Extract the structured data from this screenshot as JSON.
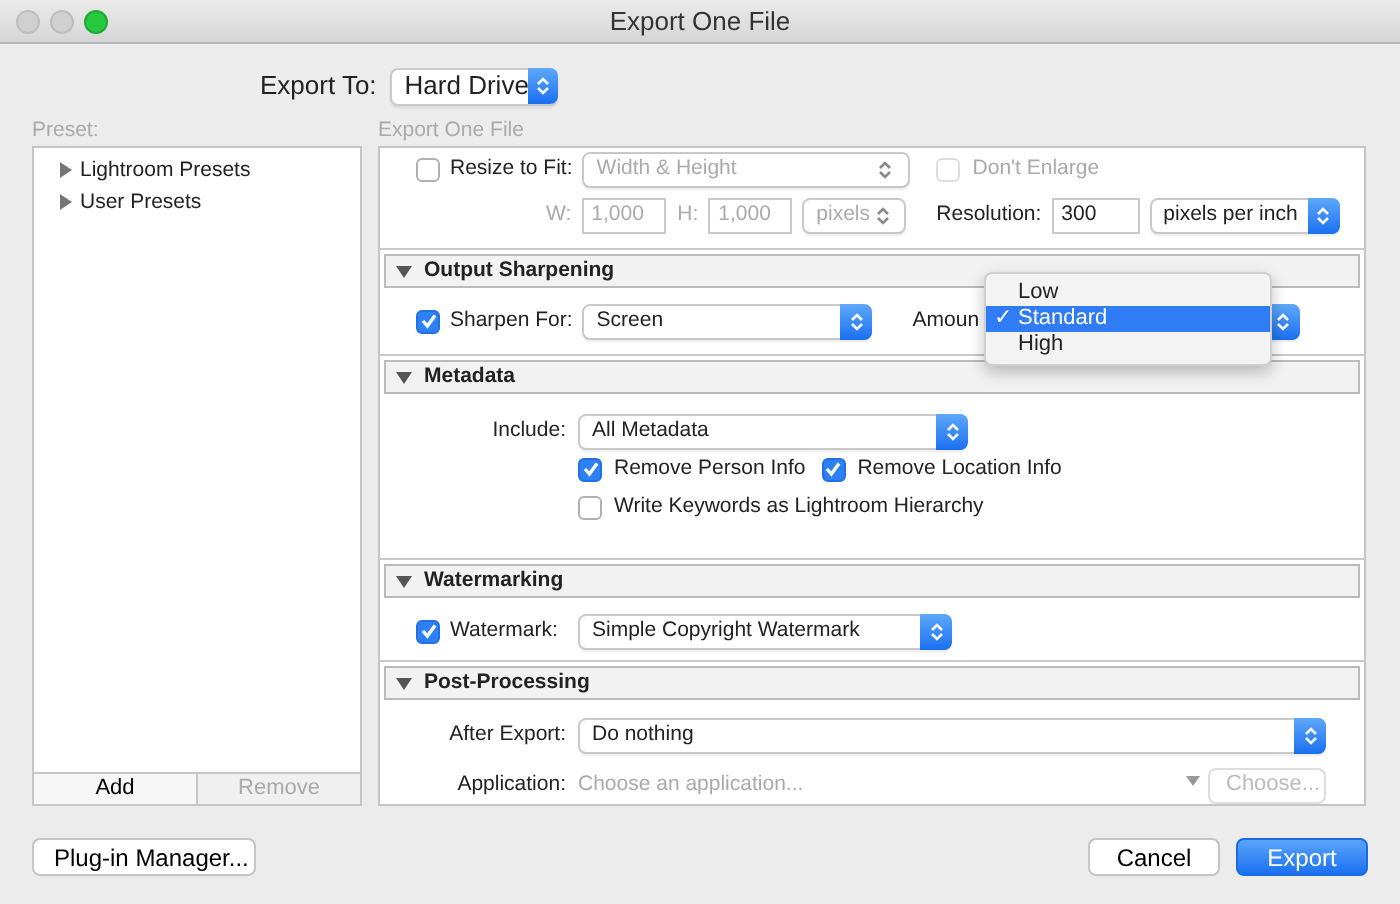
{
  "window": {
    "title": "Export One File"
  },
  "export_to": {
    "label": "Export To:",
    "value": "Hard Drive"
  },
  "preset_panel": {
    "heading": "Preset:",
    "items": [
      {
        "label": "Lightroom Presets",
        "expanded": false
      },
      {
        "label": "User Presets",
        "expanded": false
      }
    ],
    "buttons": [
      {
        "label": "Add",
        "disabled": false
      },
      {
        "label": "Remove",
        "disabled": true
      }
    ]
  },
  "settings": {
    "heading": "Export One File",
    "resize": {
      "label": "Resize to Fit:",
      "checked": false,
      "mode": "Width & Height",
      "dont_enlarge": {
        "label": "Don't Enlarge",
        "checked": false
      },
      "w_label": "W:",
      "w_value": "1,000",
      "h_label": "H:",
      "h_value": "1,000",
      "unit": "pixels"
    },
    "resolution": {
      "label": "Resolution:",
      "value": "300",
      "unit": "pixels per inch"
    },
    "sections": [
      {
        "kind": "sharpening",
        "title": "Output Sharpening",
        "expanded": true,
        "sharpen_for": {
          "label": "Sharpen For:",
          "checked": true,
          "value": "Screen"
        },
        "amount_label": "Amoun",
        "amount_menu": {
          "check_glyph": "✓",
          "items": [
            {
              "label": "Low",
              "selected": false
            },
            {
              "label": "Standard",
              "selected": true
            },
            {
              "label": "High",
              "selected": false
            }
          ]
        }
      },
      {
        "kind": "metadata",
        "title": "Metadata",
        "expanded": true,
        "include_label": "Include:",
        "include_value": "All Metadata",
        "option_rows": [
          [
            {
              "label": "Remove Person Info",
              "checked": true
            },
            {
              "label": "Remove Location Info",
              "checked": true
            }
          ],
          [
            {
              "label": "Write Keywords as Lightroom Hierarchy",
              "checked": false
            }
          ]
        ]
      },
      {
        "kind": "watermarking",
        "title": "Watermarking",
        "expanded": true,
        "watermark": {
          "label": "Watermark:",
          "checked": true,
          "value": "Simple Copyright Watermark"
        }
      },
      {
        "kind": "post",
        "title": "Post-Processing",
        "expanded": true,
        "after_export_label": "After Export:",
        "after_export_value": "Do nothing",
        "application_label": "Application:",
        "application_placeholder": "Choose an application...",
        "choose_button": {
          "label": "Choose...",
          "disabled": true
        }
      }
    ]
  },
  "footer": {
    "plugin_button": "Plug-in Manager...",
    "cancel_button": "Cancel",
    "export_button": "Export"
  }
}
